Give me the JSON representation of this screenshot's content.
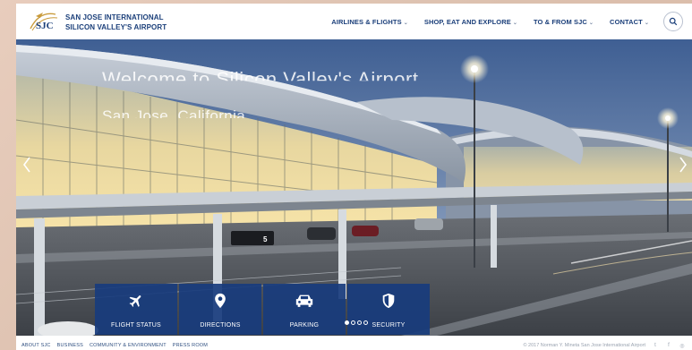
{
  "header": {
    "logo_text": "SJC",
    "logo_title_line1": "SAN JOSE INTERNATIONAL",
    "logo_title_line2": "SILICON VALLEY'S AIRPORT",
    "nav": [
      {
        "label": "AIRLINES & FLIGHTS"
      },
      {
        "label": "SHOP, EAT AND EXPLORE"
      },
      {
        "label": "TO & FROM SJC"
      },
      {
        "label": "CONTACT"
      }
    ],
    "search_icon": "search-icon"
  },
  "hero": {
    "title": "Welcome to Silicon Valley's Airport",
    "subtitle": "San Jose, California",
    "bus_sign": "5"
  },
  "quick_links": [
    {
      "label": "FLIGHT STATUS",
      "icon": "plane-icon"
    },
    {
      "label": "DIRECTIONS",
      "icon": "map-pin-icon"
    },
    {
      "label": "PARKING",
      "icon": "car-icon"
    },
    {
      "label": "SECURITY",
      "icon": "shield-icon"
    }
  ],
  "slider": {
    "dots": 4,
    "active": 1
  },
  "footer": {
    "links": [
      {
        "label": "ABOUT SJC"
      },
      {
        "label": "BUSINESS"
      },
      {
        "label": "COMMUNITY & ENVIRONMENT"
      },
      {
        "label": "PRESS ROOM"
      }
    ],
    "copyright": "© 2017 Norman Y. Mineta San Jose International Airport",
    "social": [
      {
        "icon": "twitter-icon",
        "glyph": "t"
      },
      {
        "icon": "facebook-icon",
        "glyph": "f"
      },
      {
        "icon": "instagram-icon",
        "glyph": "◎"
      }
    ]
  },
  "colors": {
    "brand_blue": "#1b3f7a",
    "tile_blue": "#183c7d"
  }
}
